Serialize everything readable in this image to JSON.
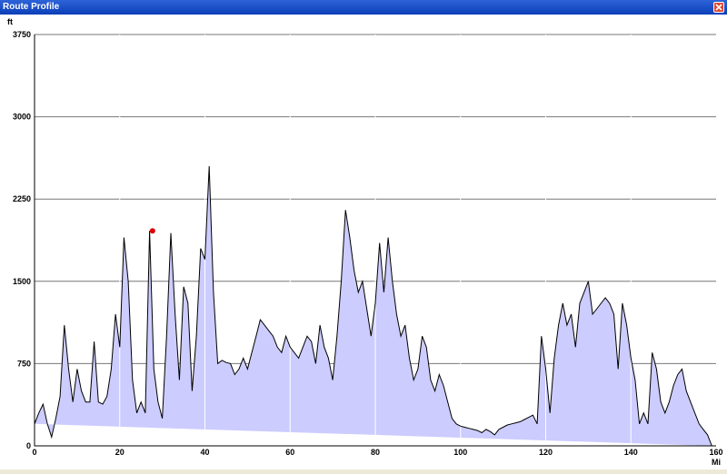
{
  "window": {
    "title": "Route Profile",
    "close_icon": "close-icon"
  },
  "colors": {
    "titlebar": "#0b3fb8",
    "fill": "#ccccff",
    "line": "#000000",
    "marker": "#dd0000",
    "grid_h": "#777777",
    "grid_v": "#ffffff"
  },
  "chart_data": {
    "type": "area",
    "xlabel": "Mi",
    "ylabel": "ft",
    "xlim": [
      0,
      160
    ],
    "ylim": [
      0,
      3750
    ],
    "xticks": [
      0,
      20,
      40,
      60,
      80,
      100,
      120,
      140,
      160
    ],
    "yticks": [
      0,
      750,
      1500,
      2250,
      3000,
      3750
    ],
    "grid": true,
    "marker": {
      "x": 27.7,
      "y": 1960
    },
    "x": [
      0,
      1,
      2,
      3,
      4,
      5,
      6,
      7,
      8,
      9,
      10,
      11,
      12,
      13,
      14,
      15,
      16,
      17,
      18,
      19,
      20,
      21,
      22,
      23,
      24,
      25,
      26,
      27,
      28,
      29,
      30,
      31,
      32,
      33,
      34,
      35,
      36,
      37,
      38,
      39,
      40,
      41,
      42,
      43,
      44,
      45,
      46,
      47,
      48,
      49,
      50,
      51,
      52,
      53,
      54,
      55,
      56,
      57,
      58,
      59,
      60,
      61,
      62,
      63,
      64,
      65,
      66,
      67,
      68,
      69,
      70,
      71,
      72,
      73,
      74,
      75,
      76,
      77,
      78,
      79,
      80,
      81,
      82,
      83,
      84,
      85,
      86,
      87,
      88,
      89,
      90,
      91,
      92,
      93,
      94,
      95,
      96,
      97,
      98,
      99,
      100,
      101,
      102,
      103,
      104,
      105,
      106,
      107,
      108,
      109,
      110,
      111,
      112,
      113,
      114,
      115,
      116,
      117,
      118,
      119,
      120,
      121,
      122,
      123,
      124,
      125,
      126,
      127,
      128,
      129,
      130,
      131,
      132,
      133,
      134,
      135,
      136,
      137,
      138,
      139,
      140,
      141,
      142,
      143,
      144,
      145,
      146,
      147,
      148,
      149,
      150,
      151,
      152,
      153,
      154,
      155,
      156,
      157,
      158,
      159,
      160
    ],
    "y": [
      200,
      300,
      380,
      200,
      80,
      250,
      450,
      1100,
      700,
      400,
      700,
      500,
      400,
      400,
      950,
      400,
      380,
      450,
      700,
      1200,
      900,
      1900,
      1500,
      600,
      300,
      400,
      300,
      1960,
      700,
      400,
      250,
      1000,
      1940,
      1200,
      600,
      1450,
      1300,
      500,
      1000,
      1800,
      1700,
      2550,
      1400,
      750,
      780,
      760,
      750,
      650,
      700,
      800,
      700,
      850,
      1000,
      1150,
      1100,
      1050,
      1000,
      900,
      850,
      1000,
      900,
      850,
      800,
      900,
      1000,
      950,
      750,
      1100,
      900,
      800,
      600,
      1000,
      1500,
      2150,
      1900,
      1600,
      1400,
      1500,
      1250,
      1000,
      1300,
      1850,
      1400,
      1900,
      1500,
      1200,
      1000,
      1100,
      800,
      600,
      700,
      1000,
      900,
      600,
      500,
      650,
      550,
      400,
      250,
      200,
      180,
      170,
      160,
      150,
      140,
      120,
      150,
      130,
      100,
      150,
      170,
      190,
      200,
      210,
      220,
      240,
      260,
      280,
      200,
      1000,
      700,
      300,
      800,
      1100,
      1300,
      1100,
      1200,
      900,
      1300,
      1400,
      1500,
      1200,
      1250,
      1300,
      1350,
      1300,
      1200,
      700,
      1300,
      1100,
      800,
      600,
      200,
      300,
      200,
      850,
      700,
      400,
      300,
      400,
      550,
      650,
      700,
      500,
      400,
      300,
      200,
      150,
      100,
      0
    ]
  }
}
